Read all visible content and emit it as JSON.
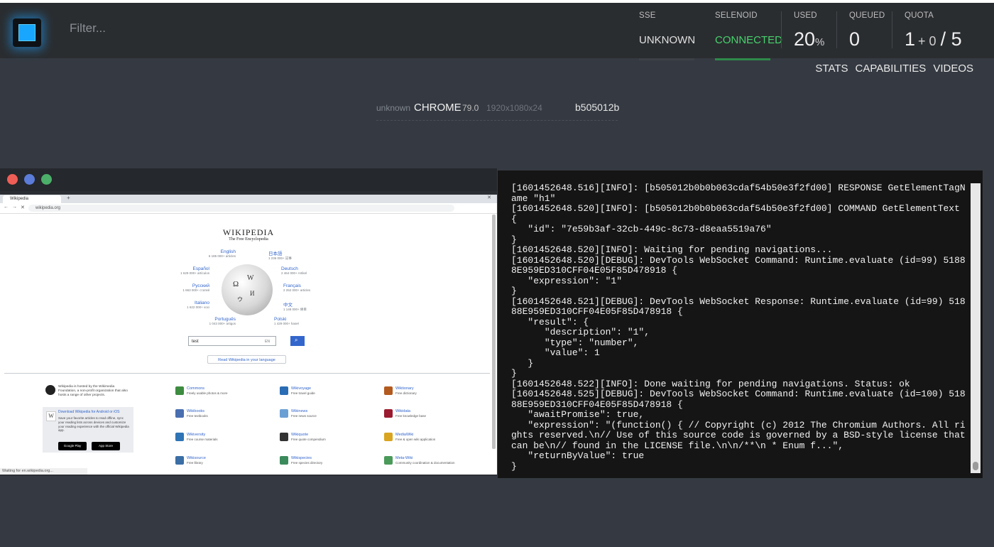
{
  "header": {
    "filter_placeholder": "Filter...",
    "sse": {
      "label": "SSE",
      "value": "UNKNOWN"
    },
    "selenoid": {
      "label": "SELENOID",
      "value": "CONNECTED",
      "color": "#47d16c"
    },
    "used": {
      "label": "USED",
      "value": "20",
      "unit": "%"
    },
    "queued": {
      "label": "QUEUED",
      "value": "0"
    },
    "quota": {
      "label": "QUOTA",
      "used": "1",
      "pending": "+ 0",
      "total": "/ 5"
    },
    "links": [
      "STATS",
      "CAPABILITIES",
      "VIDEOS"
    ]
  },
  "session": {
    "name": "unknown",
    "browser": "CHROME",
    "version": "79.0",
    "resolution": "1920x1080x24",
    "id": "b505012b"
  },
  "vnc": {
    "traffic_lights": [
      "#ee5e57",
      "#5b7cd8",
      "#4caf6a"
    ],
    "browser": {
      "tab_title": "Wikipedia",
      "url": "wikipedia.org",
      "status": "Waiting for en.wikipedia.org...",
      "page": {
        "title": "WIKIPEDIA",
        "subtitle": "The Free Encyclopedia",
        "languages": [
          {
            "name": "English",
            "count": "6 185 000+ articles"
          },
          {
            "name": "日本語",
            "count": "1 236 000+ 記事"
          },
          {
            "name": "Español",
            "count": "1 629 000+ artículos"
          },
          {
            "name": "Deutsch",
            "count": "2 464 000+ Artikel"
          },
          {
            "name": "Русский",
            "count": "1 663 000+ статей"
          },
          {
            "name": "Français",
            "count": "2 252 000+ articles"
          },
          {
            "name": "Italiano",
            "count": "1 622 000+ voci"
          },
          {
            "name": "中文",
            "count": "1 148 000+ 條目"
          },
          {
            "name": "Português",
            "count": "1 043 000+ artigos"
          },
          {
            "name": "Polski",
            "count": "1 429 000+ haseł"
          }
        ],
        "search_value": "test",
        "search_lang": "EN",
        "read_button": "Read Wikipedia in your language",
        "wmf_text": "Wikipedia is hosted by the Wikimedia Foundation, a non-profit organization that also hosts a range of other projects.",
        "app_title": "Download Wikipedia for Android or iOS",
        "app_text": "Save your favorite articles to read offline, sync your reading lists across devices and customize your reading experience with the official Wikipedia app.",
        "stores": [
          "Google Play",
          "App Store"
        ],
        "projects": [
          {
            "name": "Commons",
            "desc": "Freely usable photos & more"
          },
          {
            "name": "Wikivoyage",
            "desc": "Free travel guide"
          },
          {
            "name": "Wiktionary",
            "desc": "Free dictionary"
          },
          {
            "name": "Wikibooks",
            "desc": "Free textbooks"
          },
          {
            "name": "Wikinews",
            "desc": "Free news source"
          },
          {
            "name": "Wikidata",
            "desc": "Free knowledge base"
          },
          {
            "name": "Wikiversity",
            "desc": "Free course materials"
          },
          {
            "name": "Wikiquote",
            "desc": "Free quote compendium"
          },
          {
            "name": "MediaWiki",
            "desc": "Free & open wiki application"
          },
          {
            "name": "Wikisource",
            "desc": "Free library"
          },
          {
            "name": "Wikispecies",
            "desc": "Free species directory"
          },
          {
            "name": "Meta-Wiki",
            "desc": "Community coordination & documentation"
          }
        ]
      }
    }
  },
  "log": "[1601452648.516][INFO]: [b505012b0b0b063cdaf54b50e3f2fd00] RESPONSE GetElementTagName \"h1\"\n[1601452648.520][INFO]: [b505012b0b0b063cdaf54b50e3f2fd00] COMMAND GetElementText {\n   \"id\": \"7e59b3af-32cb-449c-8c73-d8eaa5519a76\"\n}\n[1601452648.520][INFO]: Waiting for pending navigations...\n[1601452648.520][DEBUG]: DevTools WebSocket Command: Runtime.evaluate (id=99) 51888E959ED310CFF04E05F85D478918 {\n   \"expression\": \"1\"\n}\n[1601452648.521][DEBUG]: DevTools WebSocket Response: Runtime.evaluate (id=99) 51888E959ED310CFF04E05F85D478918 {\n   \"result\": {\n      \"description\": \"1\",\n      \"type\": \"number\",\n      \"value\": 1\n   }\n}\n[1601452648.522][INFO]: Done waiting for pending navigations. Status: ok\n[1601452648.525][DEBUG]: DevTools WebSocket Command: Runtime.evaluate (id=100) 51888E959ED310CFF04E05F85D478918 {\n   \"awaitPromise\": true,\n   \"expression\": \"(function() { // Copyright (c) 2012 The Chromium Authors. All rights reserved.\\n// Use of this source code is governed by a BSD-style license that can be\\n// found in the LICENSE file.\\n\\n/**\\n * Enum f...\",\n   \"returnByValue\": true\n}"
}
